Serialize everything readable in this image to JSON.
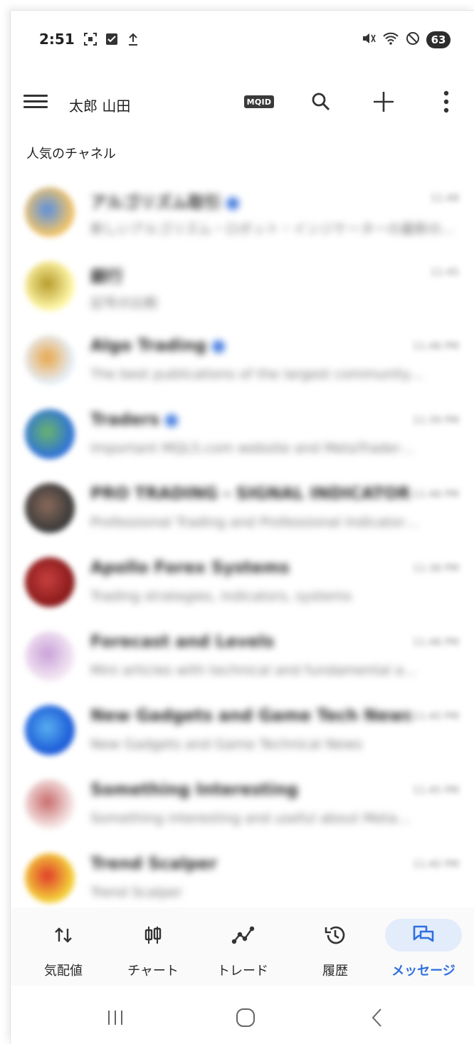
{
  "status_bar": {
    "time": "2:51",
    "battery": "63",
    "left_icons": [
      "screenshot-icon",
      "check-square-icon",
      "upload-icon"
    ],
    "right_icons": [
      "mute-vibrate-icon",
      "wifi-icon",
      "do-not-disturb-icon"
    ]
  },
  "app_bar": {
    "user_name": "太郎 山田",
    "badge": "MQID",
    "icons": [
      "menu-icon",
      "search-icon",
      "add-icon",
      "more-vert-icon"
    ]
  },
  "section": {
    "title": "人気のチャネル"
  },
  "channels": [
    {
      "name": "アルゴリズム取引",
      "verified": true,
      "time": "11:48",
      "preview": "新しいアルゴリズム・ロボット・インジケーターの最新の…",
      "avatar_colors": [
        "#f1c46a",
        "#5a8fe0"
      ]
    },
    {
      "name": "銀行",
      "verified": false,
      "time": "11:45",
      "preview": "記号の比較",
      "avatar_colors": [
        "#fff7a8",
        "#b59a2a"
      ]
    },
    {
      "name": "Algo Trading",
      "verified": true,
      "time": "11:48 PM",
      "preview": "The best publications of the largest community…",
      "avatar_colors": [
        "#e6eef7",
        "#e8a64a"
      ]
    },
    {
      "name": "Traders",
      "verified": true,
      "time": "11:39 PM",
      "preview": "Important MQL5.com website and MetaTrader…",
      "avatar_colors": [
        "#2f72d8",
        "#6ab56a"
      ]
    },
    {
      "name": "PRO TRADING - SIGNAL INDICATOR",
      "verified": false,
      "time": "11:48 PM",
      "preview": "Professional Trading and Professional Indicator…",
      "avatar_colors": [
        "#3a3a3a",
        "#8a6a5a"
      ]
    },
    {
      "name": "Apollo Forex Systems",
      "verified": false,
      "time": "11:38 PM",
      "preview": "Trading strategies, indicators, systems",
      "avatar_colors": [
        "#8a1a1a",
        "#c84040"
      ]
    },
    {
      "name": "Forecast and Levels",
      "verified": false,
      "time": "11:48 PM",
      "preview": "Mini articles with technical and fundamental a…",
      "avatar_colors": [
        "#f3e6f3",
        "#c8a0d8"
      ]
    },
    {
      "name": "New Gadgets and Game Tech News",
      "verified": false,
      "time": "11:40 PM",
      "preview": "New Gadgets and Game Technical News",
      "avatar_colors": [
        "#1a5ad8",
        "#5ab0f0"
      ]
    },
    {
      "name": "Something Interesting",
      "verified": false,
      "time": "11:45 PM",
      "preview": "Something interesting and useful about Meta…",
      "avatar_colors": [
        "#f6e6e6",
        "#c86a6a"
      ]
    },
    {
      "name": "Trend Scalper",
      "verified": false,
      "time": "11:40 PM",
      "preview": "Trend Scalper",
      "avatar_colors": [
        "#f4d23a",
        "#e03a2a"
      ]
    }
  ],
  "bottom_nav": [
    {
      "label": "気配値",
      "icon": "quotes-icon",
      "active": false
    },
    {
      "label": "チャート",
      "icon": "candlestick-icon",
      "active": false
    },
    {
      "label": "トレード",
      "icon": "trade-icon",
      "active": false
    },
    {
      "label": "履歴",
      "icon": "history-icon",
      "active": false
    },
    {
      "label": "メッセージ",
      "icon": "messages-icon",
      "active": true
    }
  ],
  "system_nav": [
    "recents-icon",
    "home-icon",
    "back-icon"
  ],
  "colors": {
    "accent": "#2f6fe0",
    "active_pill": "#e3ecfb",
    "verified": "#4a7fe0"
  }
}
